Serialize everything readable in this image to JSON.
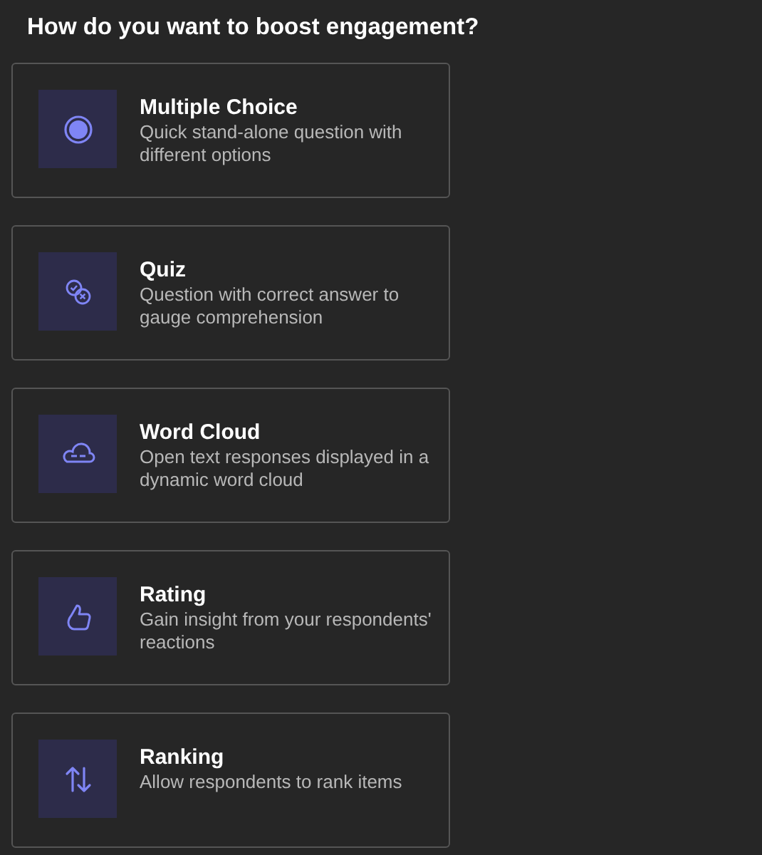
{
  "heading": "How do you want to boost engagement?",
  "options": [
    {
      "kind": "choice",
      "title": "Multiple Choice",
      "description": "Quick stand-alone question with different options"
    },
    {
      "kind": "quiz",
      "title": "Quiz",
      "description": "Question with correct answer to gauge comprehension"
    },
    {
      "kind": "cloud",
      "title": "Word Cloud",
      "description": "Open text responses displayed in a dynamic word cloud"
    },
    {
      "kind": "rating",
      "title": "Rating",
      "description": "Gain insight from your respondents' reactions"
    },
    {
      "kind": "ranking",
      "title": "Ranking",
      "description": "Allow respondents to rank items"
    }
  ]
}
